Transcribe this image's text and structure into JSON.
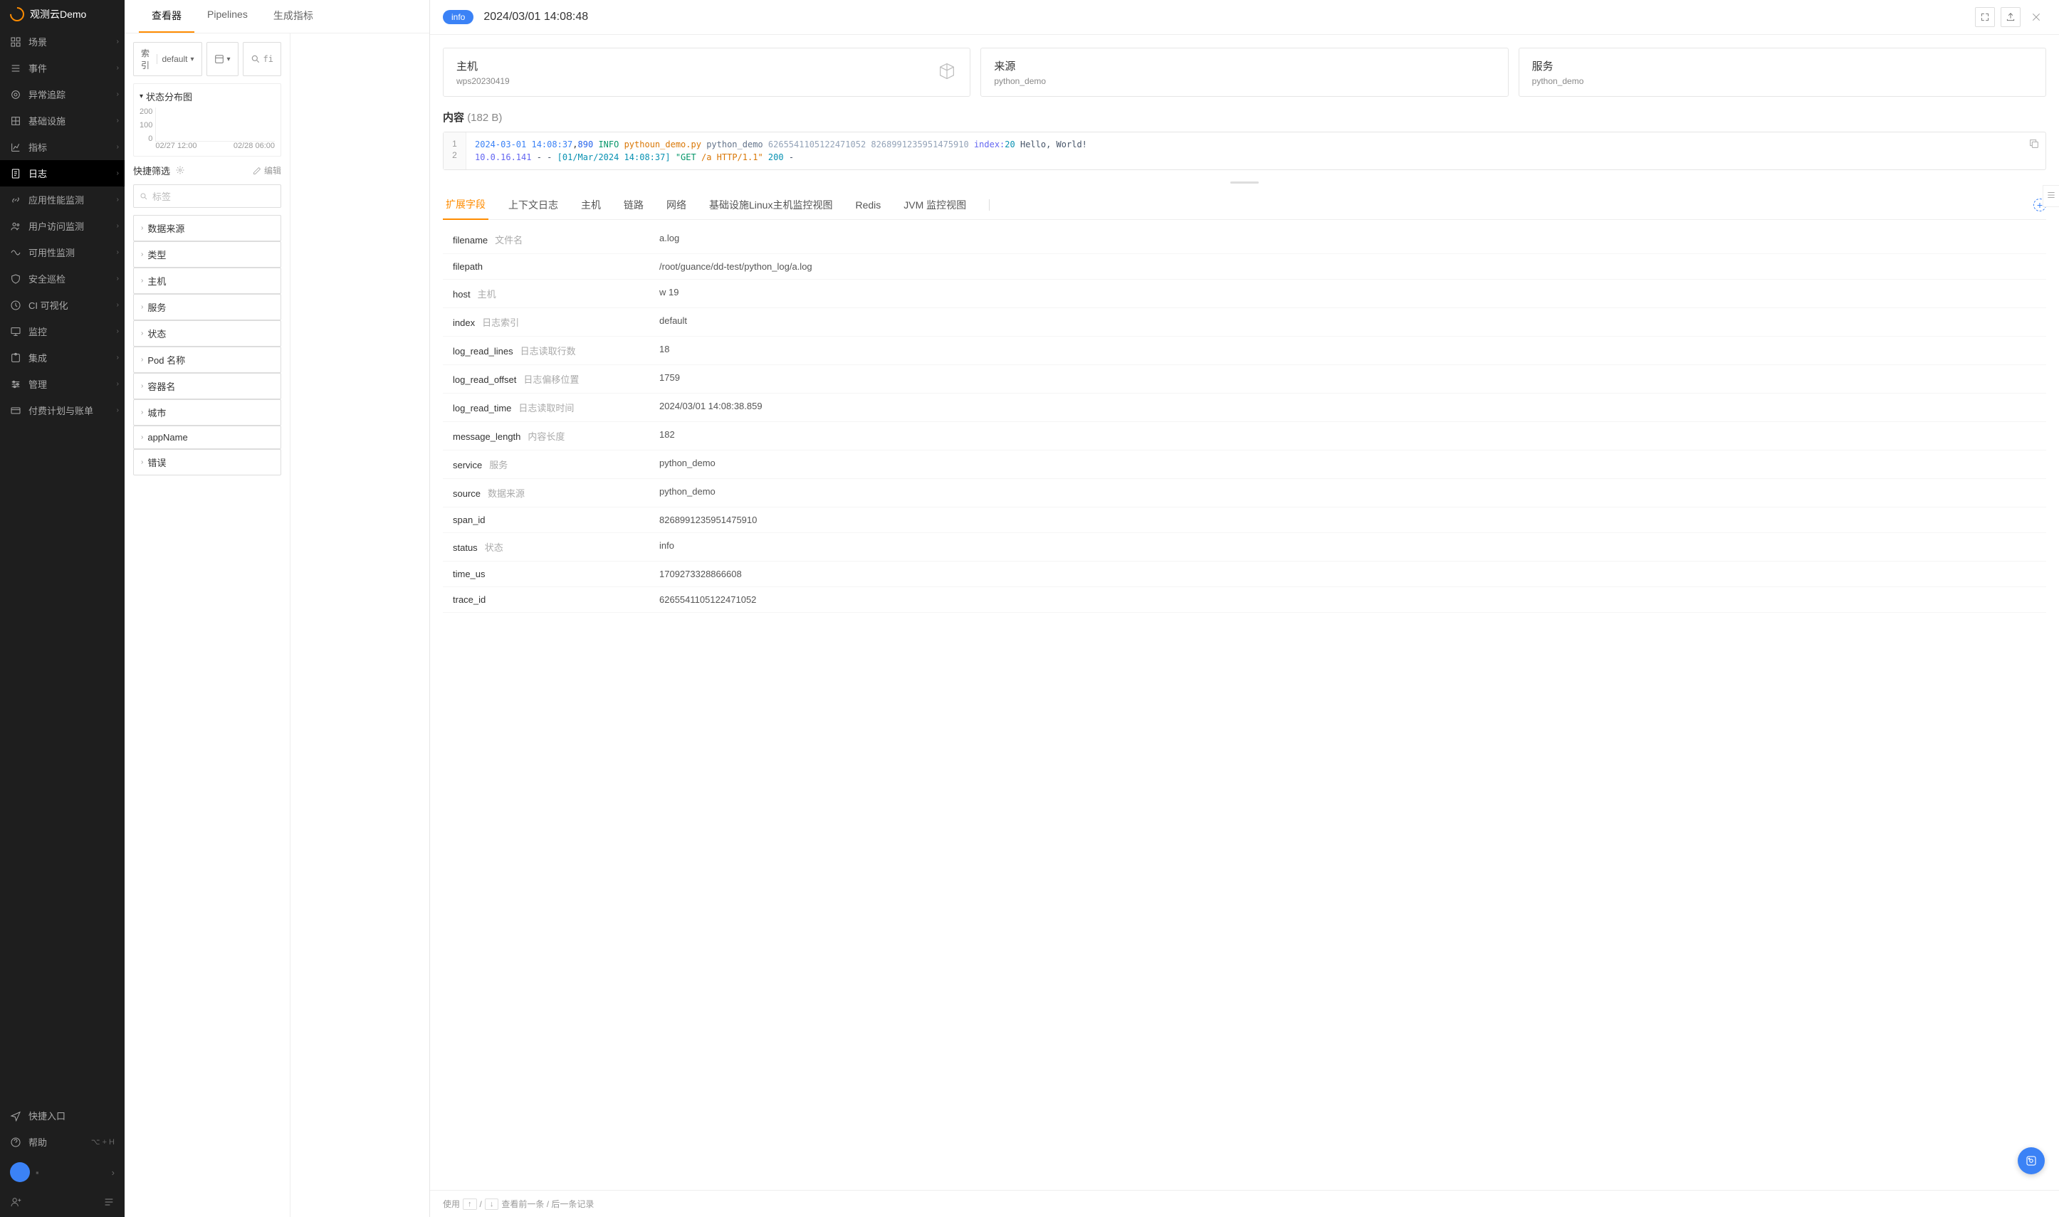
{
  "brand": "观测云Demo",
  "nav": {
    "items": [
      {
        "label": "场景",
        "icon": "layout"
      },
      {
        "label": "事件",
        "icon": "list"
      },
      {
        "label": "异常追踪",
        "icon": "target"
      },
      {
        "label": "基础设施",
        "icon": "grid"
      },
      {
        "label": "指标",
        "icon": "chart"
      },
      {
        "label": "日志",
        "icon": "doc",
        "active": true
      },
      {
        "label": "应用性能监测",
        "icon": "link"
      },
      {
        "label": "用户访问监测",
        "icon": "users"
      },
      {
        "label": "可用性监测",
        "icon": "wave"
      },
      {
        "label": "安全巡检",
        "icon": "shield"
      },
      {
        "label": "CI 可视化",
        "icon": "ci"
      },
      {
        "label": "监控",
        "icon": "monitor"
      },
      {
        "label": "集成",
        "icon": "puzzle"
      },
      {
        "label": "管理",
        "icon": "settings"
      },
      {
        "label": "付费计划与账单",
        "icon": "card"
      }
    ],
    "footItems": [
      {
        "label": "快捷入口",
        "icon": "send"
      },
      {
        "label": "帮助",
        "shortcut": "⌥ + H",
        "icon": "help"
      }
    ]
  },
  "topTabs": [
    "查看器",
    "Pipelines",
    "生成指标"
  ],
  "leftPanel": {
    "indexLabel": "索引",
    "indexValue": "default",
    "searchPlaceholder": "fi",
    "chartTitle": "状态分布图",
    "filterTitle": "快捷筛选",
    "editLabel": "编辑",
    "tagPlaceholder": "标签",
    "filters": [
      "数据来源",
      "类型",
      "主机",
      "服务",
      "状态",
      "Pod 名称",
      "容器名",
      "城市",
      "appName",
      "错误"
    ]
  },
  "chart_data": {
    "type": "bar",
    "title": "状态分布图",
    "yticks": [
      200,
      100,
      0
    ],
    "xticks": [
      "02/27 12:00",
      "02/28 06:00"
    ],
    "ylim": [
      0,
      200
    ]
  },
  "drawer": {
    "badge": "info",
    "timestamp": "2024/03/01 14:08:48",
    "cards": [
      {
        "title": "主机",
        "value": "wps20230419",
        "icon": "cube"
      },
      {
        "title": "来源",
        "value": "python_demo"
      },
      {
        "title": "服务",
        "value": "python_demo"
      }
    ],
    "contentLabel": "内容",
    "contentSize": "(182 B)",
    "code": {
      "l1": {
        "ts": "2024-03-01 14:08:37",
        "ms": "890",
        "level": "INFO",
        "file": "pythoun_demo.py",
        "module": "python_demo",
        "id1": "6265541105122471052",
        "id2": "8268991235951475910",
        "key": "index:",
        "val": "20",
        "msg": "Hello, World!"
      },
      "l2": {
        "ip": "10.0.16.141",
        "dash": "- -",
        "bracket": "[01/Mar/2024 14:08:37]",
        "method": "\"GET",
        "path": "/a",
        "proto": "HTTP/1.1\"",
        "status": "200",
        "tail": "-"
      }
    },
    "dtabs": [
      "扩展字段",
      "上下文日志",
      "主机",
      "链路",
      "网络",
      "基础设施Linux主机监控视图",
      "Redis",
      "JVM 监控视图"
    ],
    "fields": [
      {
        "k": "filename",
        "d": "文件名",
        "v": "a.log"
      },
      {
        "k": "filepath",
        "d": "",
        "v": "/root/guance/dd-test/python_log/a.log"
      },
      {
        "k": "host",
        "d": "主机",
        "v": "w             19"
      },
      {
        "k": "index",
        "d": "日志索引",
        "v": "default"
      },
      {
        "k": "log_read_lines",
        "d": "日志读取行数",
        "v": "18"
      },
      {
        "k": "log_read_offset",
        "d": "日志偏移位置",
        "v": "1759"
      },
      {
        "k": "log_read_time",
        "d": "日志读取时间",
        "v": "2024/03/01 14:08:38.859"
      },
      {
        "k": "message_length",
        "d": "内容长度",
        "v": "182"
      },
      {
        "k": "service",
        "d": "服务",
        "v": "python_demo"
      },
      {
        "k": "source",
        "d": "数据来源",
        "v": "python_demo"
      },
      {
        "k": "span_id",
        "d": "",
        "v": "8268991235951475910"
      },
      {
        "k": "status",
        "d": "状态",
        "v": "info"
      },
      {
        "k": "time_us",
        "d": "",
        "v": "1709273328866608"
      },
      {
        "k": "trace_id",
        "d": "",
        "v": "6265541105122471052"
      }
    ],
    "footer": {
      "use": "使用",
      "slash": "/",
      "hint": "查看前一条 / 后一条记录"
    }
  }
}
